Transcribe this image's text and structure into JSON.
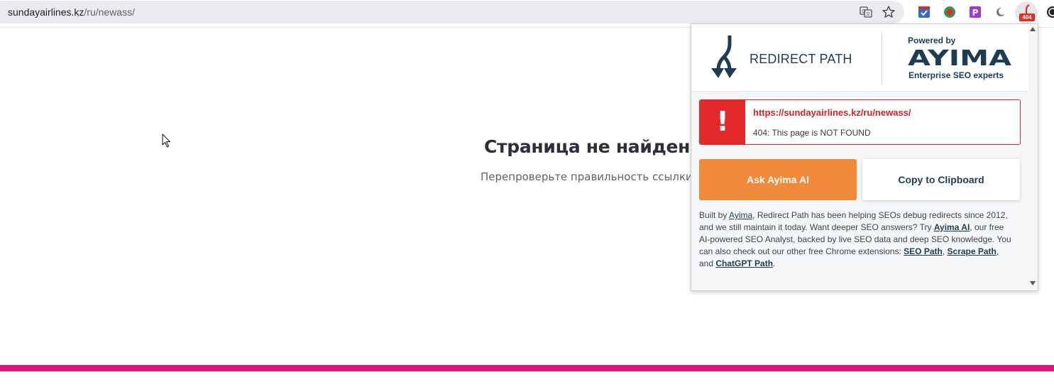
{
  "browser": {
    "url_host": "sundayairlines.kz",
    "url_path": "/ru/newass/",
    "extension_badge": "404"
  },
  "page": {
    "title": "Страница не найдена",
    "subtitle": "Перепроверьте правильность ссылки",
    "accent_color": "#e0137b"
  },
  "popup": {
    "brand_name": "REDIRECT PATH",
    "powered_by": "Powered by",
    "partner_name": "AYIMA",
    "partner_tagline": "Enterprise SEO experts",
    "result": {
      "url": "https://sundayairlines.kz/ru/newass/",
      "status": "404: This page is NOT FOUND",
      "badge": "!",
      "color": "#e32a2a"
    },
    "buttons": {
      "ask": "Ask Ayima AI",
      "copy": "Copy to Clipboard"
    },
    "about": {
      "t1": "Built by ",
      "link_ayima": "Ayima",
      "t2": ", Redirect Path has been helping SEOs debug redirects since 2012, and we still maintain it today. Want deeper SEO answers? Try ",
      "link_ayima_ai": "Ayima AI",
      "t3": ", our free AI-powered SEO Analyst, backed by live SEO data and deep SEO knowledge. You can also check out our other free Chrome extensions: ",
      "link_seo_path": "SEO Path",
      "t4": ", ",
      "link_scrape_path": "Scrape Path",
      "t5": ", and ",
      "link_chatgpt_path": "ChatGPT Path",
      "t6": "."
    }
  }
}
